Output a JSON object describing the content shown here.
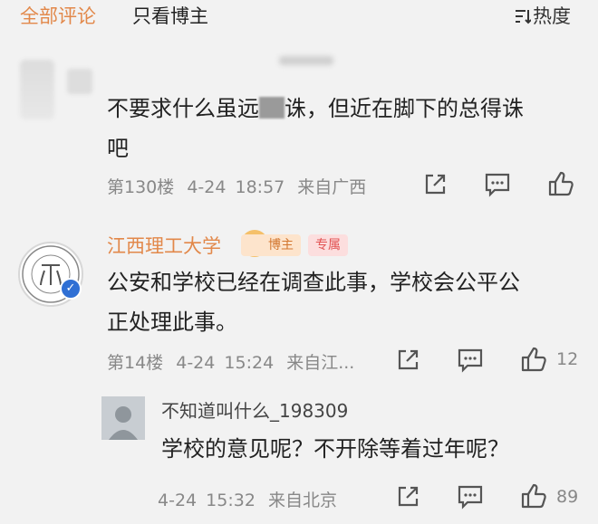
{
  "tabs": {
    "all": "全部评论",
    "author_only": "只看博主",
    "sort": "热度"
  },
  "comments": [
    {
      "text": "不要求什么虽远必诛，但近在脚下的总得诛吧",
      "text_part1": "不要求什么虽远",
      "text_part2": "诛，但近在脚下的总得诛",
      "text_part3": "吧",
      "floor": "第130楼",
      "date": "4-24",
      "time": "18:57",
      "location": "来自广西",
      "like_count": ""
    },
    {
      "author": "江西理工大学",
      "badge_author": "博主",
      "badge_special": "专属",
      "text_line1": "公安和学校已经在调查此事，学校会公平公",
      "text_line2": "正处理此事。",
      "floor": "第14楼",
      "date": "4-24",
      "time": "15:24",
      "location": "来自江...",
      "like_count": "12"
    },
    {
      "author": "不知道叫什么_198309",
      "text": "学校的意见呢？不开除等着过年呢？",
      "date": "4-24",
      "time": "15:32",
      "location": "来自北京",
      "like_count": "89"
    }
  ],
  "colors": {
    "accent": "#e2884a",
    "meta": "#888888",
    "verified": "#2f6fd4"
  },
  "icons": [
    "sort-icon",
    "share-icon",
    "comment-icon",
    "like-icon",
    "verified-icon"
  ]
}
